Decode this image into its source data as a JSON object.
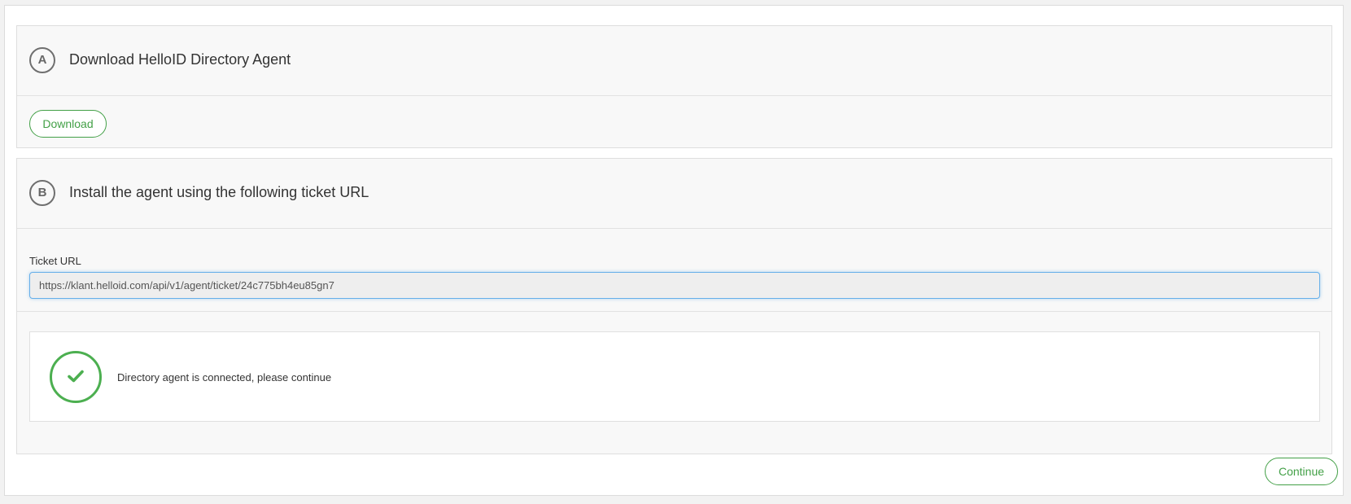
{
  "step_a": {
    "badge": "A",
    "title": "Download HelloID Directory Agent",
    "download_label": "Download"
  },
  "step_b": {
    "badge": "B",
    "title": "Install the agent using the following ticket URL",
    "ticket_label": "Ticket URL",
    "ticket_url": "https://klant.helloid.com/api/v1/agent/ticket/24c775bh4eu85gn7",
    "status_icon": "check-circle-icon",
    "status_message": "Directory agent is connected, please continue"
  },
  "footer": {
    "continue_label": "Continue"
  },
  "colors": {
    "accent_green": "#43a047",
    "input_focus": "#66afe9"
  }
}
